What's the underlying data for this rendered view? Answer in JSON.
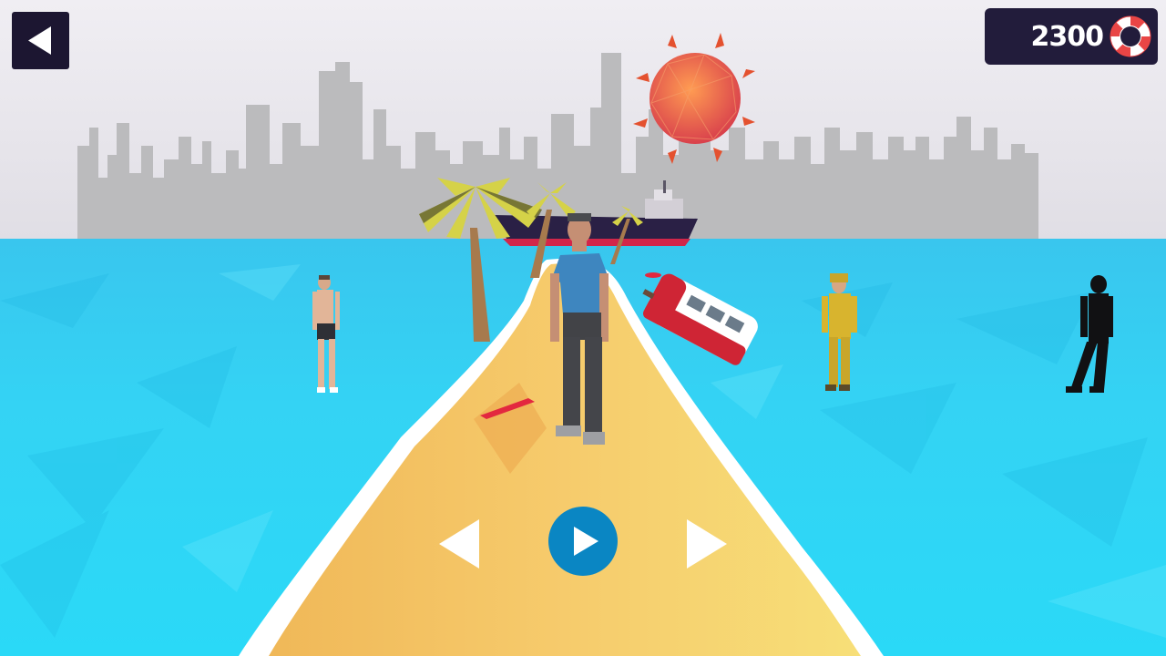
{
  "hud": {
    "score": "2300",
    "score_icon": "lifebuoy-icon",
    "back_icon": "back-arrow-icon"
  },
  "controls": {
    "prev_icon": "chevron-left-icon",
    "play_icon": "play-icon",
    "next_icon": "chevron-right-icon"
  },
  "colors": {
    "water": "#2fd3f2",
    "sand": "#f4c768",
    "sky": "#e9e7ee",
    "skyline": "#b9b9bb",
    "play_button": "#0a86c3",
    "hud_panel": "#221c3b"
  }
}
